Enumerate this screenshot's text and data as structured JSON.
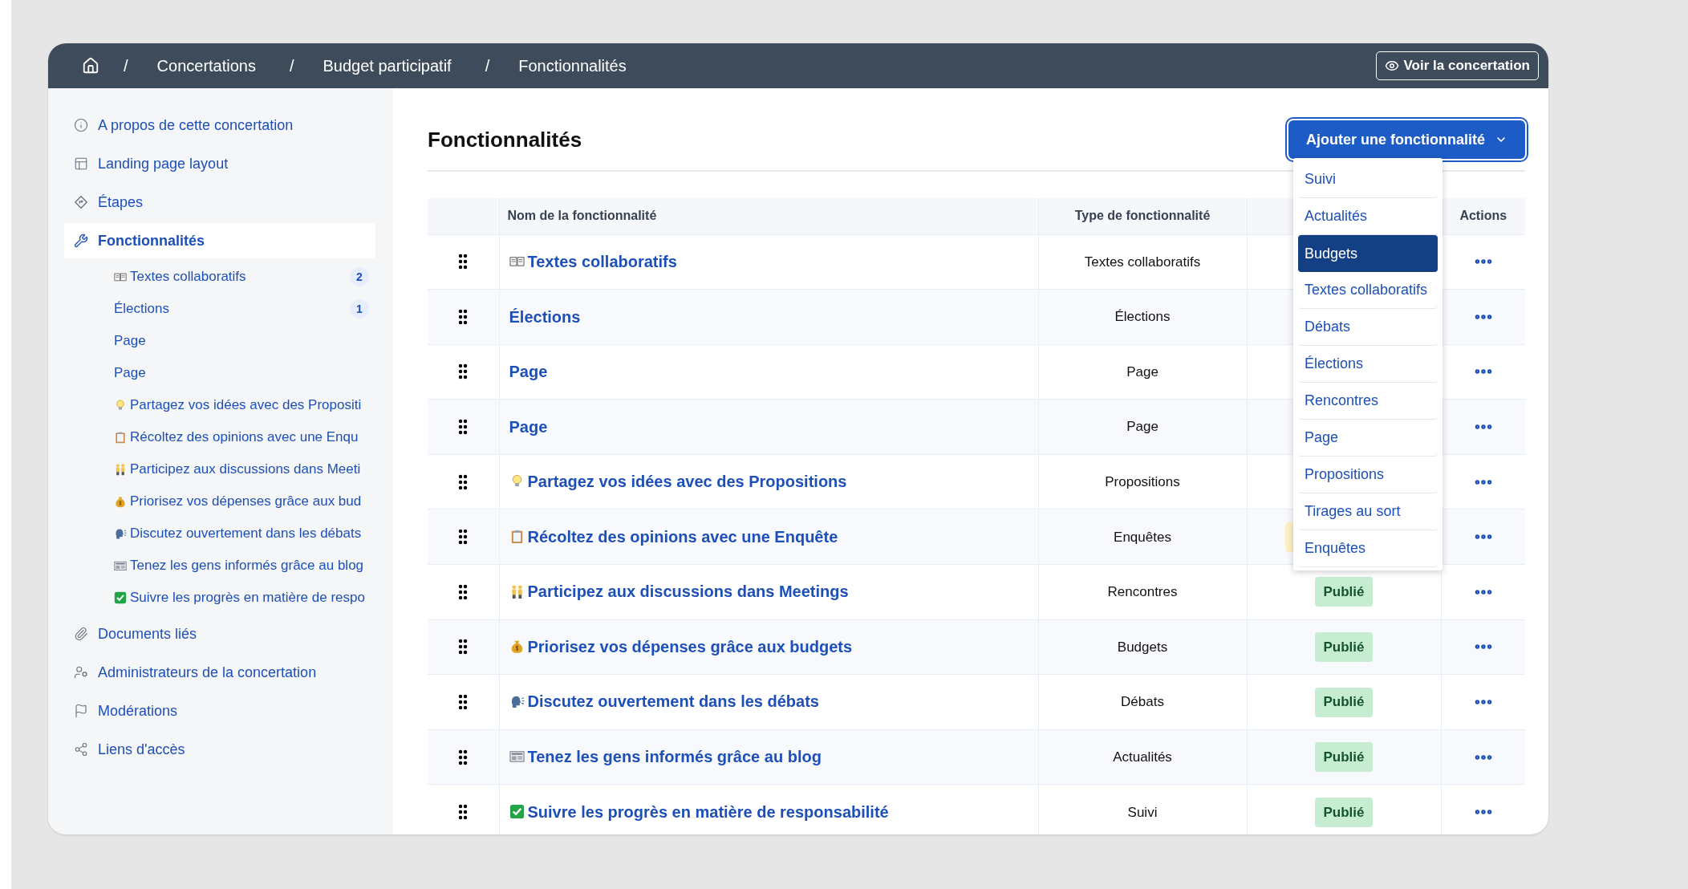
{
  "header": {
    "breadcrumbs": [
      {
        "separator": "/",
        "label": "Concertations"
      },
      {
        "separator": "/",
        "label": "Budget participatif"
      },
      {
        "separator": "/",
        "label": "Fonctionnalités"
      }
    ],
    "view_button": "Voir la concertation"
  },
  "sidebar": {
    "items": [
      {
        "kind": "about",
        "label": "A propos de cette concertation",
        "selected": false
      },
      {
        "kind": "layout",
        "label": "Landing page layout",
        "selected": false
      },
      {
        "kind": "steps",
        "label": "Étapes",
        "selected": false
      },
      {
        "kind": "features",
        "label": "Fonctionnalités",
        "selected": true,
        "children": [
          {
            "kind": "collaborative_texts",
            "label": "Textes collaboratifs",
            "count": "2"
          },
          {
            "kind": "elections",
            "label": "Élections",
            "count": "1"
          },
          {
            "kind": "page",
            "label": "Page"
          },
          {
            "kind": "page",
            "label": "Page"
          },
          {
            "kind": "proposals",
            "label": "Partagez vos idées avec des Propositi"
          },
          {
            "kind": "surveys",
            "label": "Récoltez des opinions avec une Enqu"
          },
          {
            "kind": "meetings",
            "label": "Participez aux discussions dans Meeti"
          },
          {
            "kind": "budgets",
            "label": "Priorisez vos dépenses grâce aux bud"
          },
          {
            "kind": "debates",
            "label": "Discutez ouvertement dans les débats"
          },
          {
            "kind": "blog",
            "label": "Tenez les gens informés grâce au blog"
          },
          {
            "kind": "accountability",
            "label": "Suivre les progrès en matière de respo"
          }
        ]
      },
      {
        "kind": "documents",
        "label": "Documents liés",
        "selected": false
      },
      {
        "kind": "admins",
        "label": "Administrateurs de la concertation",
        "selected": false
      },
      {
        "kind": "moderation",
        "label": "Modérations",
        "selected": false
      },
      {
        "kind": "links",
        "label": "Liens d'accès",
        "selected": false
      }
    ]
  },
  "main": {
    "title": "Fonctionnalités",
    "add_button": "Ajouter une fonctionnalité",
    "dropdown": [
      {
        "label": "Suivi",
        "selected": false
      },
      {
        "label": "Actualités",
        "selected": false
      },
      {
        "label": "Budgets",
        "selected": true
      },
      {
        "label": "Textes collaboratifs",
        "selected": false
      },
      {
        "label": "Débats",
        "selected": false
      },
      {
        "label": "Élections",
        "selected": false
      },
      {
        "label": "Rencontres",
        "selected": false
      },
      {
        "label": "Page",
        "selected": false
      },
      {
        "label": "Propositions",
        "selected": false
      },
      {
        "label": "Tirages au sort",
        "selected": false
      },
      {
        "label": "Enquêtes",
        "selected": false
      }
    ],
    "table": {
      "columns": [
        "Nom de la fonctionnalité",
        "Type de fonctionnalité",
        "Actions"
      ],
      "rows": [
        {
          "kind": "collaborative_texts",
          "name": "Textes collaboratifs",
          "type": "Textes collaboratifs"
        },
        {
          "kind": "elections",
          "name": "Élections",
          "type": "Élections"
        },
        {
          "kind": "page",
          "name": "Page",
          "type": "Page"
        },
        {
          "kind": "page",
          "name": "Page",
          "type": "Page"
        },
        {
          "kind": "proposals",
          "name": "Partagez vos idées avec des Propositions",
          "type": "Propositions"
        },
        {
          "kind": "surveys",
          "name": "Récoltez des opinions avec une Enquête",
          "type": "Enquêtes",
          "status": {
            "color": "#fdf0c4"
          }
        },
        {
          "kind": "meetings",
          "name": "Participez aux discussions dans Meetings",
          "type": "Rencontres",
          "status": {
            "label": "Publié",
            "color": "#c6ecd2"
          }
        },
        {
          "kind": "budgets",
          "name": "Priorisez vos dépenses grâce aux budgets",
          "type": "Budgets",
          "status": {
            "label": "Publié",
            "color": "#c6ecd2"
          }
        },
        {
          "kind": "debates",
          "name": "Discutez ouvertement dans les débats",
          "type": "Débats",
          "status": {
            "label": "Publié",
            "color": "#c6ecd2"
          }
        },
        {
          "kind": "blog",
          "name": "Tenez les gens informés grâce au blog",
          "type": "Actualités",
          "status": {
            "label": "Publié",
            "color": "#c6ecd2"
          }
        },
        {
          "kind": "accountability",
          "name": "Suivre les progrès en matière de responsabilité",
          "type": "Suivi",
          "status": {
            "label": "Publié",
            "color": "#c6ecd2"
          }
        }
      ]
    }
  }
}
